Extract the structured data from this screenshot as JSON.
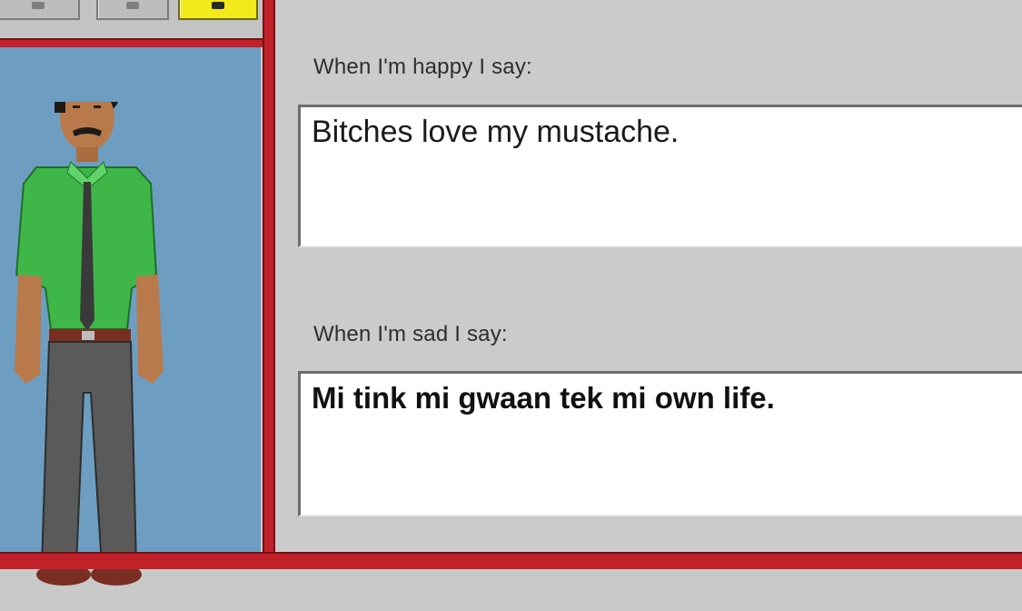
{
  "toolbar": {
    "buttons": [
      {
        "icon": "toolbar-icon-1",
        "active": false
      },
      {
        "icon": "toolbar-icon-2",
        "active": false
      },
      {
        "icon": "toolbar-icon-3",
        "active": true
      }
    ]
  },
  "colors": {
    "accent_red": "#c1222a",
    "preview_bg": "#6d9ec2",
    "panel_bg": "#cbcbcb",
    "active_button": "#f2ea1c"
  },
  "character": {
    "icon": "person-avatar",
    "shirt_color": "#3fb648",
    "pants_color": "#5a5a5a"
  },
  "phrases": {
    "happy": {
      "label": "When I'm happy I say:",
      "value": "Bitches love my mustache."
    },
    "sad": {
      "label": "When I'm sad I say:",
      "value": "Mi tink mi gwaan tek mi own life."
    }
  }
}
